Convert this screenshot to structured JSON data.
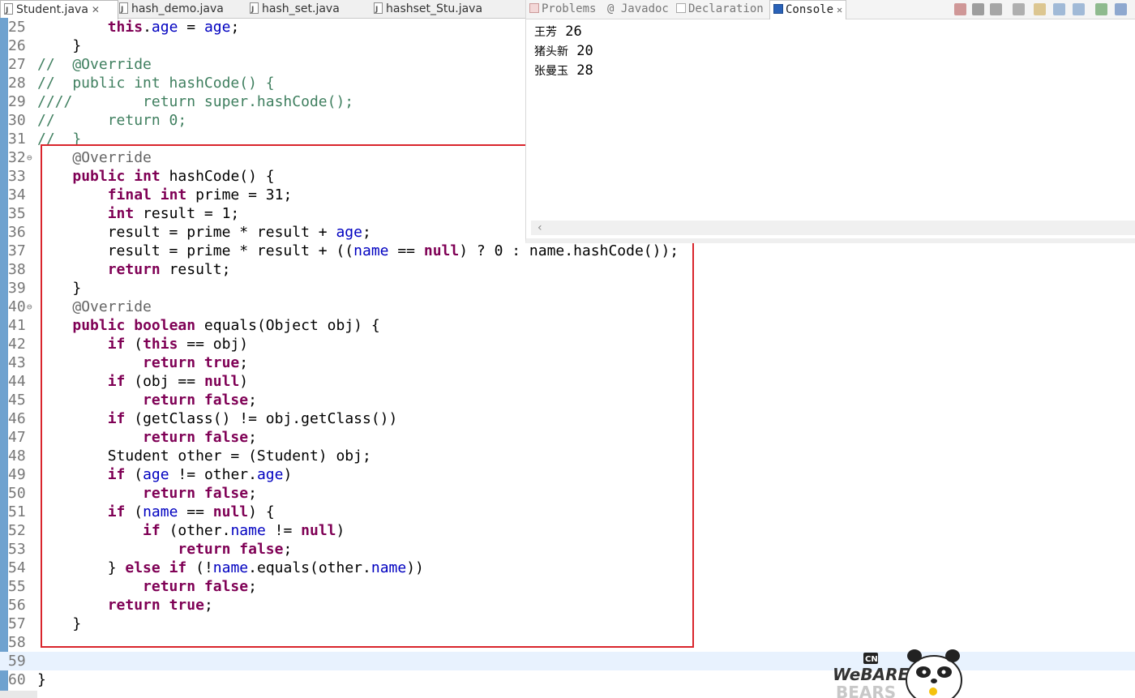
{
  "editor_tabs": [
    {
      "label": "Student.java",
      "active": true
    },
    {
      "label": "hash_demo.java"
    },
    {
      "label": "hash_set.java"
    },
    {
      "label": "hashset_Stu.java"
    }
  ],
  "code_lines": [
    {
      "num": "25",
      "text": "        this.age = age;"
    },
    {
      "num": "26",
      "text": "    }"
    },
    {
      "num": "27",
      "text": "//  @Override"
    },
    {
      "num": "28",
      "text": "//  public int hashCode() {"
    },
    {
      "num": "29",
      "text": "////        return super.hashCode();"
    },
    {
      "num": "30",
      "text": "//      return 0;"
    },
    {
      "num": "31",
      "text": "//  }"
    },
    {
      "num": "32",
      "text": "    @Override"
    },
    {
      "num": "33",
      "text": "    public int hashCode() {"
    },
    {
      "num": "34",
      "text": "        final int prime = 31;"
    },
    {
      "num": "35",
      "text": "        int result = 1;"
    },
    {
      "num": "36",
      "text": "        result = prime * result + age;"
    },
    {
      "num": "37",
      "text": "        result = prime * result + ((name == null) ? 0 : name.hashCode());"
    },
    {
      "num": "38",
      "text": "        return result;"
    },
    {
      "num": "39",
      "text": "    }"
    },
    {
      "num": "40",
      "text": "    @Override"
    },
    {
      "num": "41",
      "text": "    public boolean equals(Object obj) {"
    },
    {
      "num": "42",
      "text": "        if (this == obj)"
    },
    {
      "num": "43",
      "text": "            return true;"
    },
    {
      "num": "44",
      "text": "        if (obj == null)"
    },
    {
      "num": "45",
      "text": "            return false;"
    },
    {
      "num": "46",
      "text": "        if (getClass() != obj.getClass())"
    },
    {
      "num": "47",
      "text": "            return false;"
    },
    {
      "num": "48",
      "text": "        Student other = (Student) obj;"
    },
    {
      "num": "49",
      "text": "        if (age != other.age)"
    },
    {
      "num": "50",
      "text": "            return false;"
    },
    {
      "num": "51",
      "text": "        if (name == null) {"
    },
    {
      "num": "52",
      "text": "            if (other.name != null)"
    },
    {
      "num": "53",
      "text": "                return false;"
    },
    {
      "num": "54",
      "text": "        } else if (!name.equals(other.name))"
    },
    {
      "num": "55",
      "text": "            return false;"
    },
    {
      "num": "56",
      "text": "        return true;"
    },
    {
      "num": "57",
      "text": "    }"
    },
    {
      "num": "58",
      "text": ""
    },
    {
      "num": "59",
      "text": ""
    },
    {
      "num": "60",
      "text": "}"
    }
  ],
  "console_tabs": [
    {
      "label": "Problems",
      "icon": "problems-icon"
    },
    {
      "label": "@ Javadoc",
      "icon": "javadoc-icon"
    },
    {
      "label": "Declaration",
      "icon": "declaration-icon"
    },
    {
      "label": "Console",
      "icon": "console-icon",
      "active": true
    }
  ],
  "console_output": [
    {
      "name": "王芳",
      "age": "26"
    },
    {
      "name": "猪头新",
      "age": "20"
    },
    {
      "name": "张曼玉",
      "age": "28"
    }
  ],
  "console_toolbar_icons": [
    "terminate-icon",
    "remove-launch-icon",
    "remove-all-icon",
    "clear-console-icon",
    "scroll-lock-icon",
    "show-console-output-icon",
    "show-console-error-icon",
    "pin-console-icon",
    "display-selected-console-icon"
  ],
  "watermark": {
    "brand": "CN",
    "text_top": "WeBARE",
    "text_bottom": "BEARS"
  },
  "colors": {
    "keyword": "#7f0055",
    "field": "#0000c0",
    "comment": "#3f7f5f",
    "annotation": "#646464",
    "highlight_box": "#d9252c",
    "current_line": "#e8f2fe"
  }
}
